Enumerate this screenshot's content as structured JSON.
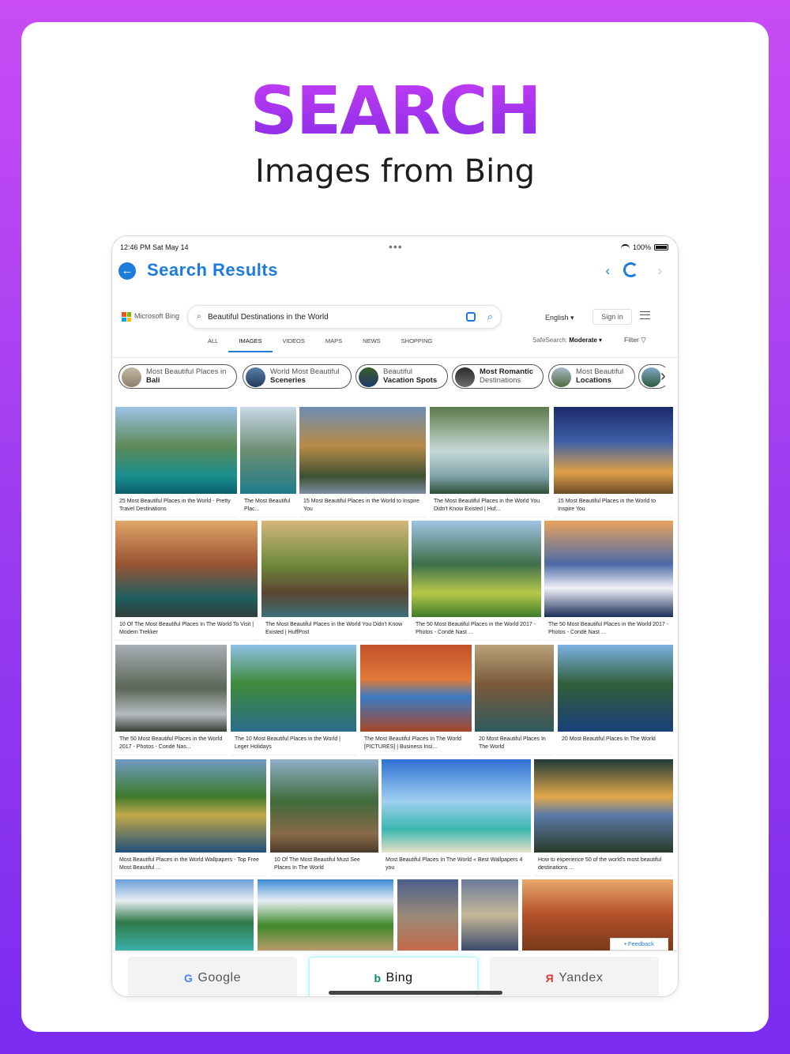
{
  "hero": {
    "title": "SEARCH",
    "subtitle": "Images from Bing"
  },
  "status_bar": {
    "time": "12:46 PM   Sat May 14",
    "battery": "100%"
  },
  "nav": {
    "title": "Search Results"
  },
  "bing": {
    "logo_text": "Microsoft Bing",
    "query": "Beautiful Destinations in the World",
    "language": "English ▾",
    "sign_in": "Sign in",
    "scopes": [
      "ALL",
      "IMAGES",
      "VIDEOS",
      "MAPS",
      "NEWS",
      "SHOPPING"
    ],
    "safesearch_label": "SafeSearch:",
    "safesearch_value": "Moderate ▾",
    "filter": "Filter ▽"
  },
  "chips": [
    {
      "line1": "Most Beautiful Places in",
      "line2": "Bali"
    },
    {
      "line1": "World Most Beautiful",
      "line2": "Sceneries"
    },
    {
      "line1": "Beautiful",
      "line2": "Vacation Spots"
    },
    {
      "line1": "Most Romantic",
      "line2": "Destinations"
    },
    {
      "line1": "Most Beautiful",
      "line2": "Locations"
    }
  ],
  "results": [
    {
      "caption": "25 Most Beautiful Places in the World - Pretty Travel Destinations"
    },
    {
      "caption": "The Most Beautiful Plac..."
    },
    {
      "caption": "15 Most Beautiful Places in the World to Inspire You"
    },
    {
      "caption": "The Most Beautiful Places in the World You Didn't Know Existed | Huf..."
    },
    {
      "caption": "15 Most Beautiful Places in the World to Inspire You"
    },
    {
      "caption": "10 Of The Most Beautiful Places In The World To Visit | Modern Trekker"
    },
    {
      "caption": "The Most Beautiful Places in the World You Didn't Know Existed | HuffPost"
    },
    {
      "caption": "The 50 Most Beautiful Places in the World 2017 - Photos - Condé Nast ..."
    },
    {
      "caption": "The 50 Most Beautiful Places in the World 2017 - Photos - Condé Nast ..."
    },
    {
      "caption": "The 50 Most Beautiful Places in the World 2017 - Photos - Condé Nas..."
    },
    {
      "caption": "The 10 Most Beautiful Places in the World | Leger Holidays"
    },
    {
      "caption": "The Most Beautiful Places In The World [PICTURES] | Business Insi..."
    },
    {
      "caption": "20 Most Beautiful Places In The World"
    },
    {
      "caption": "20 Most Beautiful Places In The World"
    },
    {
      "caption": "Most Beautiful Places in the World Wallpapers - Top Free Most Beautiful ..."
    },
    {
      "caption": "10 Of The Most Beautiful Must See Places In The World"
    },
    {
      "caption": "Most Beautiful Places In The World « Best Wallpapers 4 you"
    },
    {
      "caption": "How to experience 50 of the world's most beautiful destinations ..."
    },
    {
      "caption": ""
    },
    {
      "caption": ""
    },
    {
      "caption": ""
    },
    {
      "caption": ""
    },
    {
      "caption": ""
    }
  ],
  "feedback": "Feedback",
  "engines": [
    {
      "icon": "G",
      "label": "Google"
    },
    {
      "icon": "b",
      "label": "Bing"
    },
    {
      "icon": "Я",
      "label": "Yandex"
    }
  ],
  "colors": {
    "accent": "#1d7bd9",
    "gradient_top": "#c94cf5",
    "gradient_bottom": "#7a2cf0"
  }
}
